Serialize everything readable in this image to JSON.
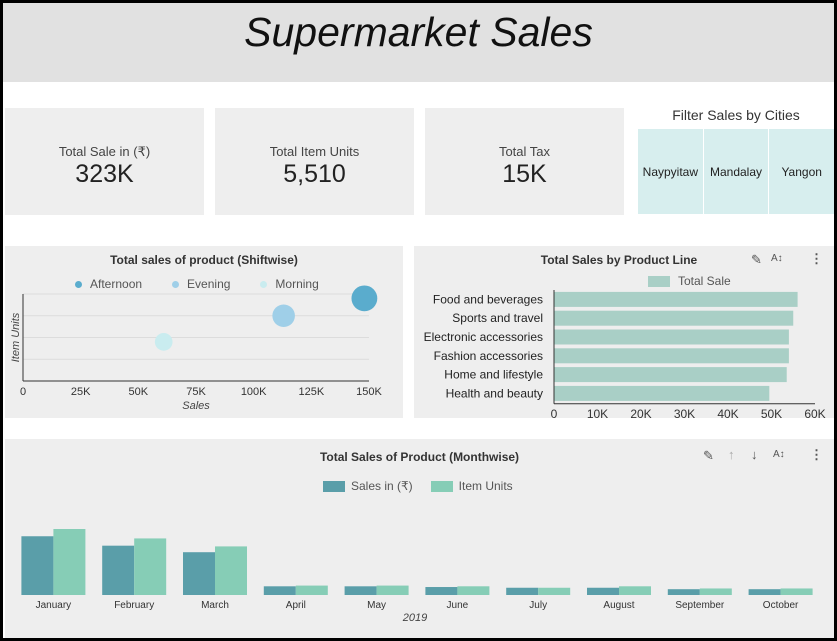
{
  "header": {
    "title": "Supermarket Sales"
  },
  "kpis": [
    {
      "label": "Total Sale in (₹)",
      "value": "323K"
    },
    {
      "label": "Total Item Units",
      "value": "5,510"
    },
    {
      "label": "Total Tax",
      "value": "15K"
    }
  ],
  "filter": {
    "title": "Filter Sales by Cities",
    "cities": [
      "Naypyitaw",
      "Mandalay",
      "Yangon"
    ]
  },
  "toolbar": {
    "edit_icon": "pencil-icon",
    "sort_icon": "sort-az-icon",
    "more_icon": "more-vert-icon",
    "up_icon": "arrow-up-icon",
    "down_icon": "arrow-down-icon"
  },
  "colors": {
    "afternoon": "#5aaccd",
    "evening": "#9fcfe8",
    "morning": "#c9ecef",
    "product_bar": "#a9cfc6",
    "sales_bar": "#5a9ea9",
    "units_bar": "#86cdb6"
  },
  "chart_data": [
    {
      "type": "scatter",
      "title": "Total sales of product (Shiftwise)",
      "xlabel": "Sales",
      "ylabel": "Item Units",
      "xlim": [
        0,
        150000
      ],
      "x_ticks": [
        "0",
        "25K",
        "50K",
        "75K",
        "100K",
        "125K",
        "150K"
      ],
      "legend_position": "top",
      "series": [
        {
          "name": "Afternoon",
          "x": 148000,
          "y": 1900
        },
        {
          "name": "Evening",
          "x": 113000,
          "y": 1500
        },
        {
          "name": "Morning",
          "x": 61000,
          "y": 900
        }
      ]
    },
    {
      "type": "bar",
      "orientation": "horizontal",
      "title": "Total Sales by Product Line",
      "legend": [
        "Total Sale"
      ],
      "categories": [
        "Food and beverages",
        "Sports and travel",
        "Electronic accessories",
        "Fashion accessories",
        "Home and lifestyle",
        "Health and beauty"
      ],
      "values": [
        56000,
        55000,
        54000,
        54000,
        53500,
        49500
      ],
      "xlim": [
        0,
        60000
      ],
      "x_ticks": [
        "0",
        "10K",
        "20K",
        "30K",
        "40K",
        "50K",
        "60K"
      ]
    },
    {
      "type": "bar",
      "title": "Total Sales of Product (Monthwise)",
      "xlabel": "2019",
      "categories": [
        "January",
        "February",
        "March",
        "April",
        "May",
        "June",
        "July",
        "August",
        "September",
        "October"
      ],
      "series": [
        {
          "name": "Sales in (₹)",
          "values": [
            81,
            68,
            59,
            12,
            12,
            11,
            10,
            10,
            8,
            8
          ]
        },
        {
          "name": "Item Units",
          "values": [
            91,
            78,
            67,
            13,
            13,
            12,
            10,
            12,
            9,
            9
          ]
        }
      ]
    }
  ]
}
